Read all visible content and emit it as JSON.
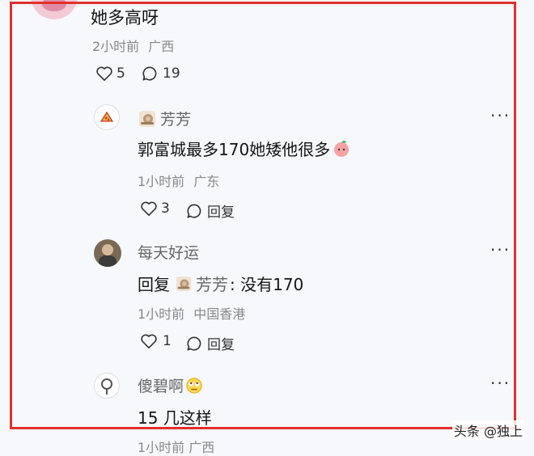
{
  "main_comment": {
    "text": "她多高呀",
    "time": "2小时前",
    "location": "广西",
    "likes": "5",
    "replies": "19"
  },
  "replies": [
    {
      "name": "芳芳",
      "text": "郭富城最多170她矮他很多",
      "time": "1小时前",
      "location": "广东",
      "likes": "3",
      "reply_label": "回复"
    },
    {
      "name": "每天好运",
      "reply_prefix": "回复",
      "reply_to": "芳芳",
      "reply_body": ": 没有170",
      "time": "1小时前",
      "location": "中国香港",
      "likes": "1",
      "reply_label": "回复"
    },
    {
      "name": "傻碧啊",
      "text": "15 几这样",
      "cutoff_meta": "1小时前  广西"
    }
  ],
  "watermark": "头条 @独上",
  "colors": {
    "highlight_border": "#e0302a",
    "background": "#f7f8fc"
  }
}
